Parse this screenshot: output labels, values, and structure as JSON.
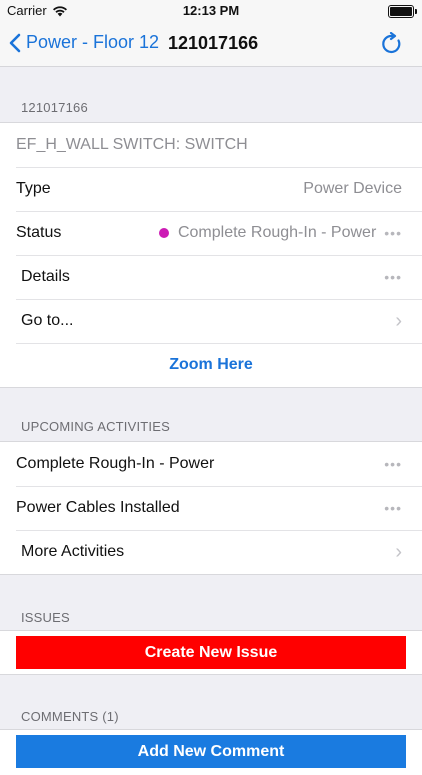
{
  "status_bar": {
    "carrier": "Carrier",
    "time": "12:13 PM"
  },
  "nav": {
    "back_label": "Power - Floor 12",
    "title": "121017166"
  },
  "item": {
    "header": "121017166",
    "name": "EF_H_WALL SWITCH: SWITCH",
    "type_label": "Type",
    "type_value": "Power Device",
    "status_label": "Status",
    "status_value": "Complete Rough-In - Power",
    "status_color": "#cc1bb4",
    "details_label": "Details",
    "goto_label": "Go to...",
    "zoom_label": "Zoom Here"
  },
  "upcoming": {
    "header": "UPCOMING ACTIVITIES",
    "items": [
      {
        "label": "Complete Rough-In - Power"
      },
      {
        "label": "Power Cables Installed"
      }
    ],
    "more_label": "More Activities"
  },
  "issues": {
    "header": "ISSUES",
    "create_label": "Create New Issue"
  },
  "comments": {
    "header": "COMMENTS (1)",
    "add_label": "Add New Comment"
  },
  "colors": {
    "accent": "#1a73d9",
    "danger": "#ff0000",
    "button_blue": "#1a7be0"
  }
}
